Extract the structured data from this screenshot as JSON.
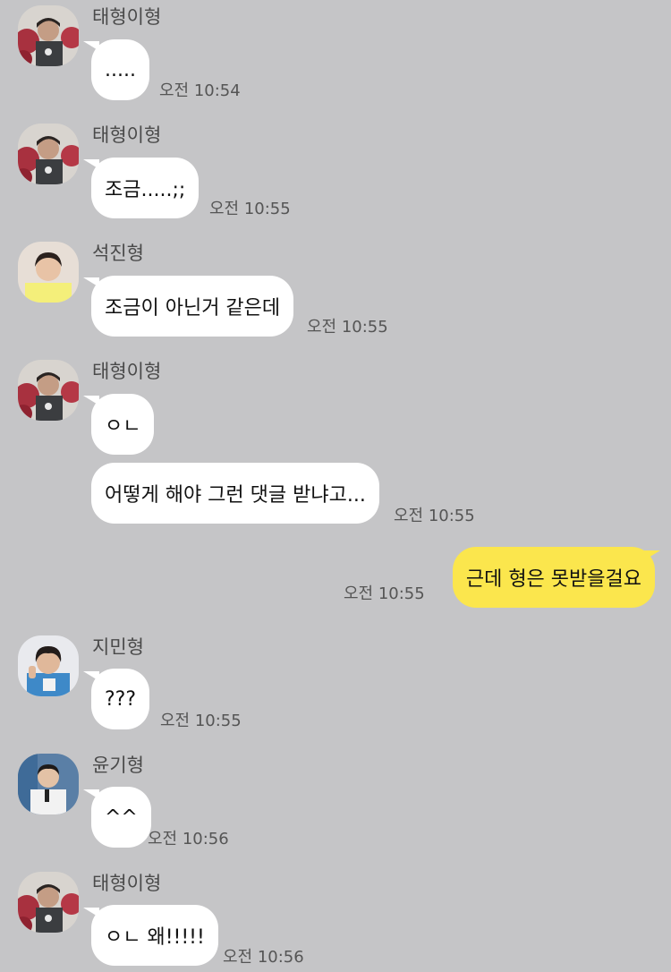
{
  "colors": {
    "background": "#c5c5c7",
    "incoming_bubble": "#ffffff",
    "outgoing_bubble": "#fbe64d",
    "name_text": "#4a4a4a",
    "time_text": "#555555"
  },
  "messages": [
    {
      "sender": "태형이형",
      "avatar": "taehyung-avatar",
      "text": ".....",
      "time": "오전 10:54"
    },
    {
      "sender": "태형이형",
      "avatar": "taehyung-avatar",
      "text": "조금.....;;",
      "time": "오전 10:55"
    },
    {
      "sender": "석진형",
      "avatar": "seokjin-avatar",
      "text": "조금이 아닌거 같은데",
      "time": "오전 10:55"
    },
    {
      "sender": "태형이형",
      "avatar": "taehyung-avatar",
      "text": "ㅇㄴ",
      "text2": "어떻게 해야 그런 댓글 받냐고...",
      "time": "오전 10:55"
    },
    {
      "sender": "me",
      "text": "근데 형은 못받을걸요",
      "time": "오전 10:55"
    },
    {
      "sender": "지민형",
      "avatar": "jimin-avatar",
      "text": "???",
      "time": "오전 10:55"
    },
    {
      "sender": "윤기형",
      "avatar": "yoongi-avatar",
      "text": "^^",
      "time": "오전 10:56"
    },
    {
      "sender": "태형이형",
      "avatar": "taehyung-avatar",
      "text": "ㅇㄴ 왜!!!!!",
      "time": "오전 10:56"
    }
  ]
}
